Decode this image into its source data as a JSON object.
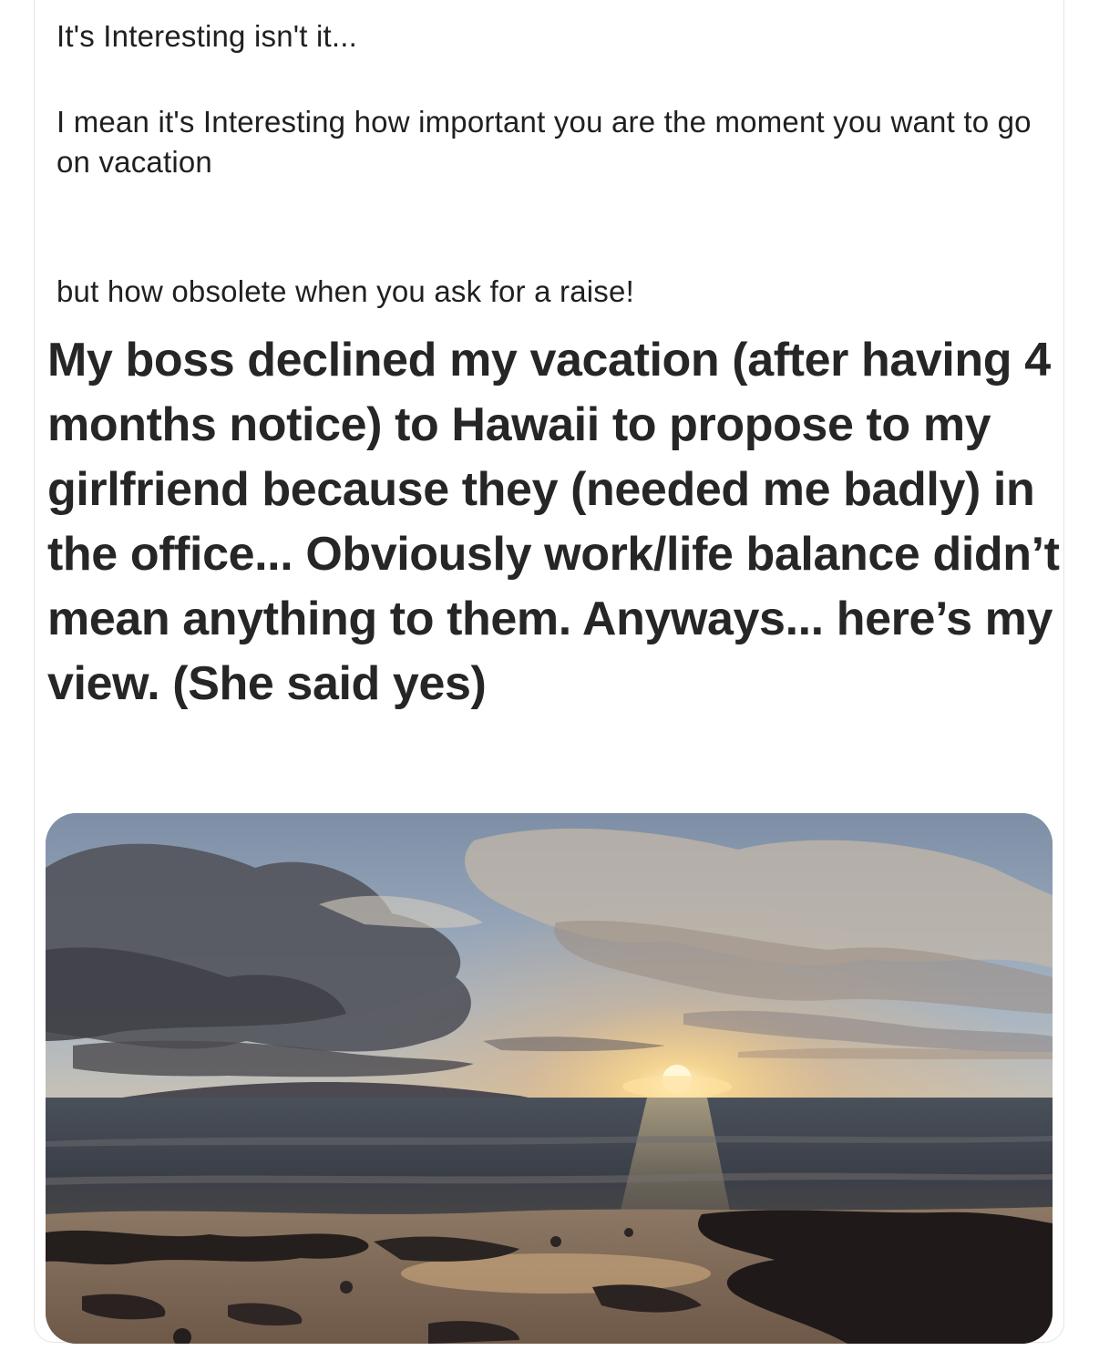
{
  "post": {
    "caption_line1": "It's Interesting isn't it...",
    "caption_line2": "I mean it's Interesting how important you are the moment you want to go on vacation",
    "caption_line3": "but how obsolete when you ask for a raise!"
  },
  "embedded_screenshot": {
    "text": "My boss declined my vacation (after having 4 months notice) to Hawaii to propose to my girlfriend because they (needed me badly) in the office... Obviously work/life balance didn’t mean anything to them. Anyways... here’s my view. (She said yes)"
  },
  "photo": {
    "subject": "sunset-over-ocean-beach",
    "colors": {
      "sky_top": "#8fa4bd",
      "sky_mid": "#c9bfae",
      "horizon_glow": "#f3c27a",
      "sun": "#fff3c4",
      "sea": "#3f4550",
      "sand": "#8a705a",
      "rocks": "#1e1b1a"
    }
  }
}
